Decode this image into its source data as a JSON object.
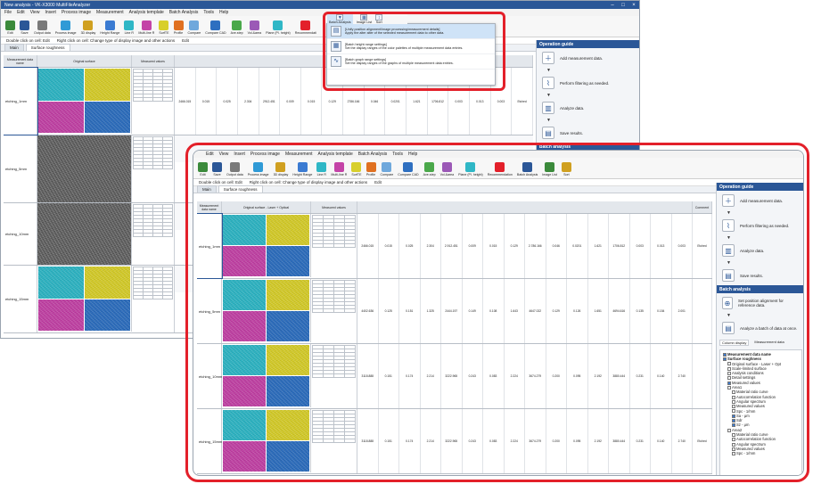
{
  "back_window": {
    "title": "New analysis - VK-X3000 MultiFileAnalyzer",
    "menu": [
      "File",
      "Edit",
      "View",
      "Insert",
      "Process image",
      "Measurement",
      "Analysis template",
      "Batch Analysis",
      "Tools",
      "Help"
    ],
    "ribbon": [
      "Edit",
      "Save",
      "Output data",
      "Process image",
      "3D display",
      "Height Range",
      "Line R",
      "Multi-line R",
      "SurfTE",
      "Profile",
      "Compare",
      "Compare CAD",
      "Ave.step",
      "Vol.&area",
      "Plane (Pl. height)",
      "Recommendati"
    ],
    "info_left": "Double click on cell: Edit",
    "info_right": "Right click on cell: Change type of display image and other actions",
    "info_edit": "Edit",
    "tabs": [
      "Main",
      "Surface roughness"
    ],
    "rows": [
      {
        "name": "etching_1mm",
        "type": "color"
      },
      {
        "name": "etching_5mm",
        "type": "gray"
      },
      {
        "name": "etching_10mm",
        "type": "gray"
      },
      {
        "name": "etching_15mm",
        "type": "color"
      }
    ]
  },
  "popup": {
    "ribbon_labels": [
      "Batch Analysis",
      "Image List",
      "Sort"
    ],
    "items": [
      {
        "title": "[Unify position alignment/image processing/measurement details]",
        "desc": "Apply the alter alter of the selected measurement data to other data.",
        "icon": "batch-unify-icon"
      },
      {
        "title": "[Batch height range settings]",
        "desc": "Set the display ranges of the color palettes of multiple measurement data entries.",
        "icon": "height-range-icon"
      },
      {
        "title": "[Batch graph range settings]",
        "desc": "Set the display ranges of the graphs of multiple measurement data entries.",
        "icon": "graph-range-icon"
      }
    ]
  },
  "back_panel": {
    "header": "Operation guide",
    "steps": [
      "Add measurement data.",
      "Perform filtering as needed.",
      "Analyze data.",
      "Save results."
    ],
    "batch_header": "Batch analysis"
  },
  "front_window": {
    "menu": [
      "Edit",
      "View",
      "Insert",
      "Process image",
      "Measurement",
      "Analysis template",
      "Batch Analysis",
      "Tools",
      "Help"
    ],
    "ribbon": [
      "Edit",
      "Save",
      "Output data",
      "Process image",
      "3D display",
      "Height Range",
      "Line R",
      "Multi-line R",
      "SurfTE",
      "Profile",
      "Compare",
      "Compare CAD",
      "Ave.step",
      "Vol.&area",
      "Plane (Pl. height)",
      "Recommendation",
      "Batch Analysis",
      "Image List",
      "Sort"
    ],
    "info_left": "Double click on cell: Edit",
    "info_right": "Right click on cell: Change type of display image and other actions",
    "info_edit": "Edit",
    "tabs": [
      "Main",
      "Surface roughness"
    ],
    "col_header_name": "Measurement data name",
    "col_header_image": "Original surface - Laser + Optical",
    "col_header_values": "Measured values",
    "col_header_comment": "Comment",
    "rows": [
      {
        "name": "etching_1mm",
        "vals": [
          "2466.015",
          "0.015",
          "0.025",
          "2.304",
          "2.912.451",
          "0.009",
          "0.015",
          "0.129",
          "2.786.166",
          "0.046",
          "0.0201",
          "1.621",
          "1706.812",
          "0.003",
          "0.013",
          "0.003",
          "Etched"
        ]
      },
      {
        "name": "etching_5mm",
        "vals": [
          "4402.636",
          "0.125",
          "0.151",
          "1.325",
          "2444.197",
          "0.149",
          "0.108",
          "1.643",
          "4647.022",
          "0.129",
          "0.126",
          "1.651",
          "4694.616",
          "0.135",
          "0.154",
          "2.001",
          ""
        ]
      },
      {
        "name": "etching_10mm",
        "vals": [
          "3118.888",
          "0.151",
          "0.174",
          "2.214",
          "3222.965",
          "0.243",
          "0.083",
          "2.224",
          "3674.279",
          "0.200",
          "0.095",
          "2.192",
          "3880.444",
          "0.231",
          "0.140",
          "2.740",
          ""
        ]
      },
      {
        "name": "etching_15mm",
        "vals": [
          "3118.888",
          "0.151",
          "0.174",
          "2.214",
          "3222.965",
          "0.243",
          "0.083",
          "2.224",
          "3674.279",
          "0.200",
          "0.095",
          "2.192",
          "3880.444",
          "0.231",
          "0.140",
          "2.740",
          "Etched"
        ]
      }
    ]
  },
  "front_panel": {
    "header": "Operation guide",
    "steps": [
      "Add measurement data.",
      "Perform filtering as needed.",
      "Analyze data.",
      "Save results."
    ],
    "batch_header": "Batch analysis",
    "batch_steps": [
      "Set position alignment for reference data.",
      "Analyze a batch of data at once."
    ],
    "tabs": [
      "Column display",
      "Measurement data"
    ],
    "tree": [
      {
        "label": "Measurement data name",
        "on": true,
        "indent": 0
      },
      {
        "label": "Surface roughness",
        "on": true,
        "indent": 0
      },
      {
        "label": "Original surface - Laser + Opt",
        "on": false,
        "indent": 1
      },
      {
        "label": "Scale-limited surface",
        "on": false,
        "indent": 1
      },
      {
        "label": "Analysis conditions",
        "on": false,
        "indent": 1
      },
      {
        "label": "Detail settings",
        "on": false,
        "indent": 1
      },
      {
        "label": "Measured values",
        "on": true,
        "indent": 1
      },
      {
        "label": "Area1",
        "on": false,
        "indent": 1
      },
      {
        "label": "Material ratio curve",
        "on": false,
        "indent": 2
      },
      {
        "label": "Autocorrelation function",
        "on": false,
        "indent": 2
      },
      {
        "label": "Angular spectrum",
        "on": false,
        "indent": 2
      },
      {
        "label": "Measured values",
        "on": false,
        "indent": 2
      },
      {
        "label": "Spc - 1/mm",
        "on": false,
        "indent": 2
      },
      {
        "label": "Sa - μm",
        "on": true,
        "indent": 2
      },
      {
        "label": "Sdr",
        "on": true,
        "indent": 2
      },
      {
        "label": "Sz - μm",
        "on": true,
        "indent": 2
      },
      {
        "label": "Area2",
        "on": false,
        "indent": 1
      },
      {
        "label": "Material ratio curve",
        "on": false,
        "indent": 2
      },
      {
        "label": "Autocorrelation function",
        "on": false,
        "indent": 2
      },
      {
        "label": "Angular spectrum",
        "on": false,
        "indent": 2
      },
      {
        "label": "Measured values",
        "on": false,
        "indent": 2
      },
      {
        "label": "Spc - 1/mm",
        "on": false,
        "indent": 2
      }
    ]
  },
  "colors": {
    "accent": "#2b5797",
    "highlight": "#e3202a",
    "cyan": "#2fb7c6",
    "yellow": "#d8cf2b",
    "magenta": "#c443a7",
    "blue": "#2e6fc0"
  }
}
